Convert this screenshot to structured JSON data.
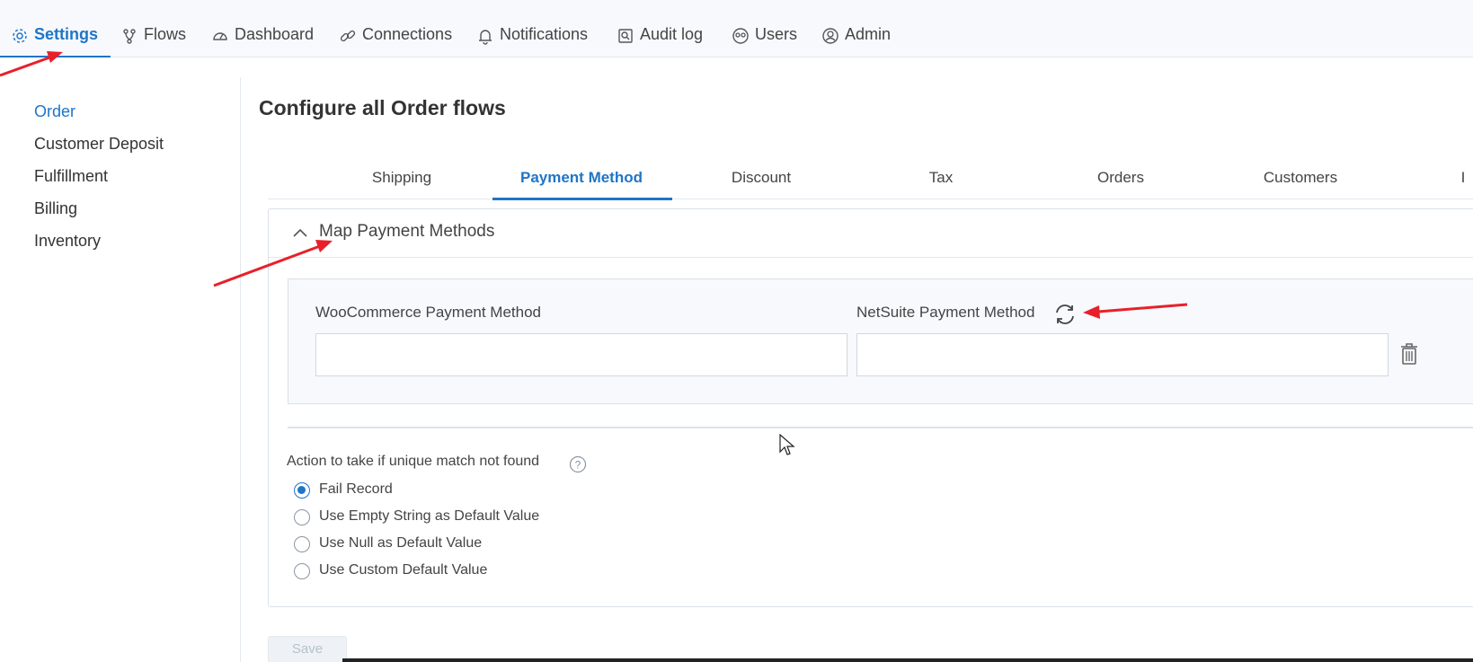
{
  "topnav": {
    "tabs": [
      {
        "label": "Settings",
        "icon": "gear-icon",
        "active": true
      },
      {
        "label": "Flows",
        "icon": "flow-icon"
      },
      {
        "label": "Dashboard",
        "icon": "dashboard-icon"
      },
      {
        "label": "Connections",
        "icon": "link-icon"
      },
      {
        "label": "Notifications",
        "icon": "bell-icon"
      },
      {
        "label": "Audit log",
        "icon": "audit-log-icon"
      },
      {
        "label": "Users",
        "icon": "users-icon"
      },
      {
        "label": "Admin",
        "icon": "admin-icon"
      }
    ]
  },
  "sidebar": {
    "items": [
      {
        "label": "Order",
        "active": true
      },
      {
        "label": "Customer Deposit"
      },
      {
        "label": "Fulfillment"
      },
      {
        "label": "Billing"
      },
      {
        "label": "Inventory"
      }
    ]
  },
  "main": {
    "title": "Configure all Order flows",
    "tabs": [
      {
        "label": "Shipping"
      },
      {
        "label": "Payment Method",
        "active": true
      },
      {
        "label": "Discount"
      },
      {
        "label": "Tax"
      },
      {
        "label": "Orders"
      },
      {
        "label": "Customers"
      },
      {
        "label": "I"
      }
    ],
    "section": {
      "title": "Map Payment Methods",
      "source_label": "WooCommerce Payment Method",
      "target_label": "NetSuite Payment Method",
      "source_value": "",
      "target_value": ""
    },
    "action": {
      "label": "Action to take if unique match not found",
      "options": [
        {
          "label": "Fail Record",
          "checked": true
        },
        {
          "label": "Use Empty String as Default Value"
        },
        {
          "label": "Use Null as Default Value"
        },
        {
          "label": "Use Custom Default Value"
        }
      ]
    },
    "save_label": "Save"
  },
  "colors": {
    "accent": "#1f75c7",
    "annotation_arrow": "#e8202a"
  }
}
